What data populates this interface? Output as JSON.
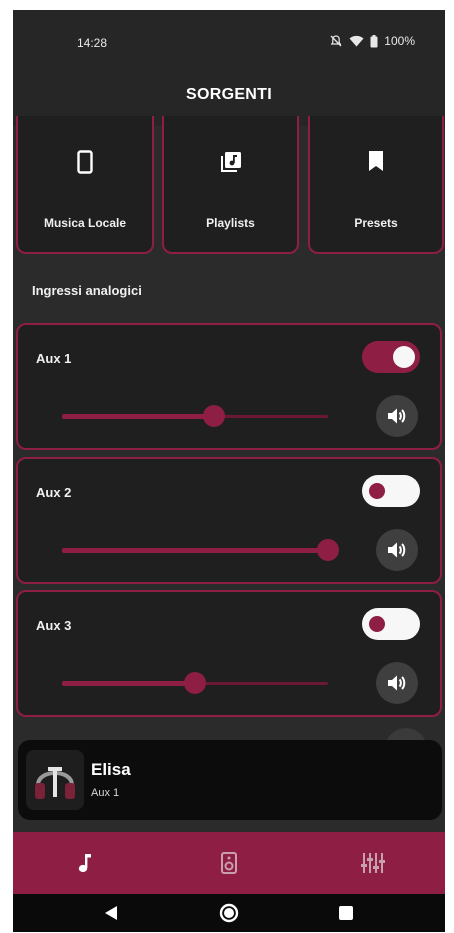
{
  "status_bar": {
    "time": "14:28",
    "battery": "100%"
  },
  "header": {
    "title": "SORGENTI"
  },
  "sources": [
    {
      "label": "Musica Locale",
      "icon": "phone-icon"
    },
    {
      "label": "Playlists",
      "icon": "library-music-icon"
    },
    {
      "label": "Presets",
      "icon": "bookmark-icon"
    }
  ],
  "section": {
    "title": "Ingressi analogici"
  },
  "aux_inputs": [
    {
      "label": "Aux 1",
      "enabled": true,
      "volume_fraction": 0.57
    },
    {
      "label": "Aux 2",
      "enabled": false,
      "volume_fraction": 1.0
    },
    {
      "label": "Aux 3",
      "enabled": false,
      "volume_fraction": 0.5
    }
  ],
  "now_playing": {
    "title": "Elisa",
    "source": "Aux 1"
  },
  "bottom_nav": [
    {
      "icon": "music-note-icon",
      "active": true
    },
    {
      "icon": "speaker-icon",
      "active": false
    },
    {
      "icon": "equalizer-icon",
      "active": false
    }
  ],
  "colors": {
    "accent": "#8e1e43",
    "background": "#2b2b2b",
    "card": "#1f1f1f"
  }
}
